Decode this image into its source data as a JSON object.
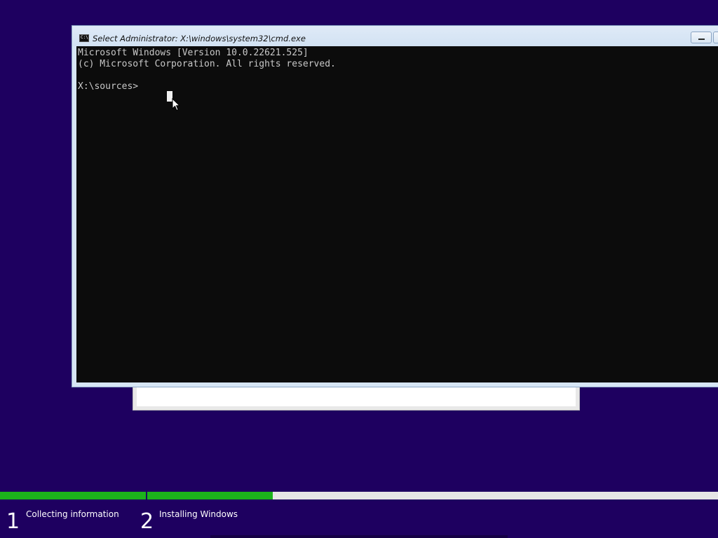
{
  "cmd_window": {
    "title": "Select Administrator: X:\\windows\\system32\\cmd.exe",
    "icon": "cmd-icon",
    "icon_glyph": "C:\\",
    "buttons": {
      "minimize_icon": "minimize-icon",
      "maximize_icon": "maximize-icon"
    },
    "console_lines": [
      "Microsoft Windows [Version 10.0.22621.525]",
      "(c) Microsoft Corporation. All rights reserved.",
      "",
      "X:\\sources>"
    ]
  },
  "setup": {
    "steps": [
      {
        "number": "1",
        "label": "Collecting information",
        "progress": 1.0
      },
      {
        "number": "2",
        "label": "Installing Windows",
        "progress": 0.22
      }
    ]
  },
  "colors": {
    "desktop_background": "#1e0060",
    "progress_fill": "#1cb31c",
    "progress_track": "#e6e6e6",
    "console_background": "#0c0c0c",
    "console_text": "#c8c8c8"
  }
}
